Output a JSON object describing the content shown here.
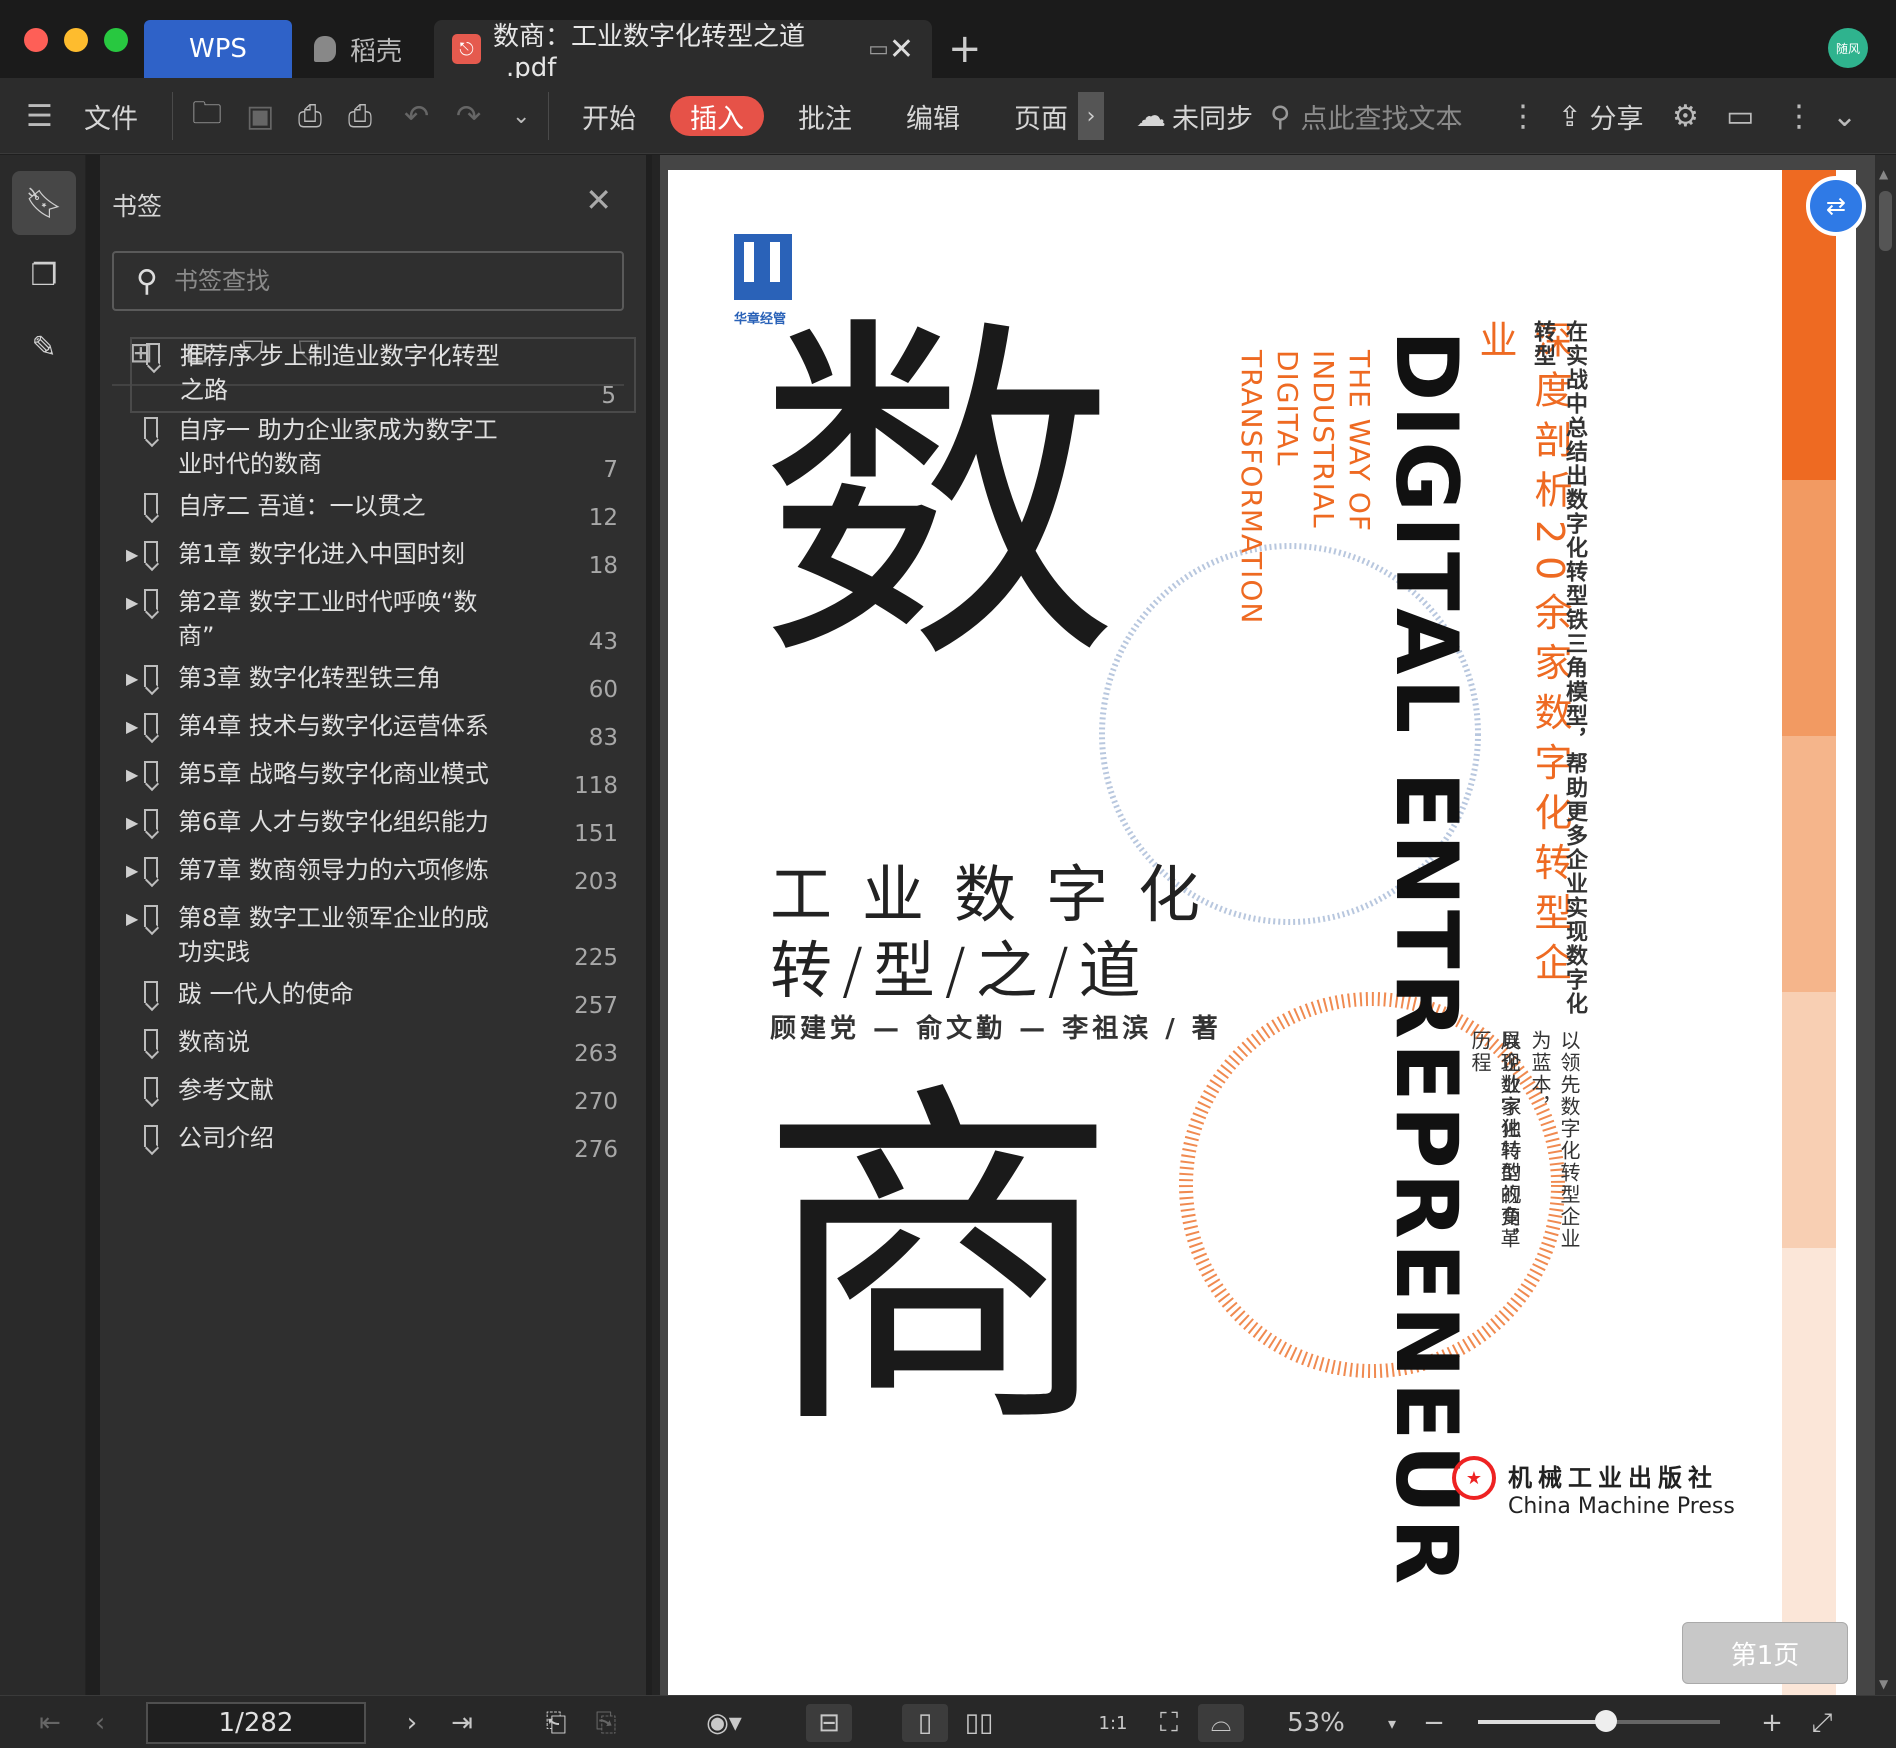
{
  "titlebar": {
    "tabs": [
      {
        "label": "WPS"
      },
      {
        "label": "稻壳"
      },
      {
        "label": "数商：工业数字化转型之道_.pdf"
      }
    ],
    "avatar_text": "随风"
  },
  "toolbar": {
    "file_label": "文件",
    "menus": [
      {
        "label": "开始"
      },
      {
        "label": "插入"
      },
      {
        "label": "批注"
      },
      {
        "label": "编辑"
      },
      {
        "label": "页面"
      }
    ],
    "sync_label": "未同步",
    "search_placeholder": "点此查找文本",
    "share_label": "分享"
  },
  "bookmark_panel": {
    "title": "书签",
    "search_placeholder": "书签查找",
    "items": [
      {
        "text": "推荐序 步上制造业数字化转型之路",
        "page": "5",
        "expandable": false,
        "selected": true
      },
      {
        "text": "自序一 助力企业家成为数字工业时代的数商",
        "page": "7",
        "expandable": false
      },
      {
        "text": "自序二 吾道：一以贯之",
        "page": "12",
        "expandable": false
      },
      {
        "text": "第1章 数字化进入中国时刻",
        "page": "18",
        "expandable": true
      },
      {
        "text": "第2章 数字工业时代呼唤“数商”",
        "page": "43",
        "expandable": true
      },
      {
        "text": "第3章 数字化转型铁三角",
        "page": "60",
        "expandable": true
      },
      {
        "text": "第4章 技术与数字化运营体系",
        "page": "83",
        "expandable": true
      },
      {
        "text": "第5章 战略与数字化商业模式",
        "page": "118",
        "expandable": true
      },
      {
        "text": "第6章 人才与数字化组织能力",
        "page": "151",
        "expandable": true
      },
      {
        "text": "第7章 数商领导力的六项修炼",
        "page": "203",
        "expandable": true
      },
      {
        "text": "第8章 数字工业领军企业的成功实践",
        "page": "225",
        "expandable": true
      },
      {
        "text": "跋 一代人的使命",
        "page": "257",
        "expandable": false
      },
      {
        "text": "数商说",
        "page": "263",
        "expandable": false
      },
      {
        "text": "参考文献",
        "page": "270",
        "expandable": false
      },
      {
        "text": "公司介绍",
        "page": "276",
        "expandable": false
      }
    ]
  },
  "cover": {
    "publisher_logo_text": "HZ BOOKS",
    "publisher_logo_caption": "华章经管",
    "big_title_1": "数",
    "big_title_2": "商",
    "subtitle_line1": "工业数字化",
    "subtitle_line2": "转/型/之/道",
    "authors": "顾建党 — 俞文勤 — 李祖滨 / 著",
    "english_title": "DIGITAL ENTREPRENEUR",
    "english_sub_1": "THE WAY OF",
    "english_sub_2": "INDUSTRIAL",
    "english_sub_3": "DIGITAL",
    "english_sub_4": "TRANSFORMATION",
    "orange_tagline": "深度剖析20余家数字化转型企业",
    "right_tagline": "在实战中总结出数字化转型铁三角模型，帮助更多企业实现数字化转型",
    "bottom_line1": "以领先数字化转型企业为蓝本，",
    "bottom_line2": "以企业家独特的视角，",
    "bottom_line3": "展现数字化转型的变革历程",
    "press_cn": "机械工业出版社",
    "press_en": "China Machine Press"
  },
  "page_badge": "第1页",
  "statusbar": {
    "page_indicator": "1/282",
    "zoom": "53%",
    "zoom_fraction": 0.53
  },
  "colors": {
    "accent_blue": "#2f62c8",
    "insert_red": "#e65248",
    "cover_orange": "#ee6a22",
    "cover_blue": "#1f4fa8"
  }
}
